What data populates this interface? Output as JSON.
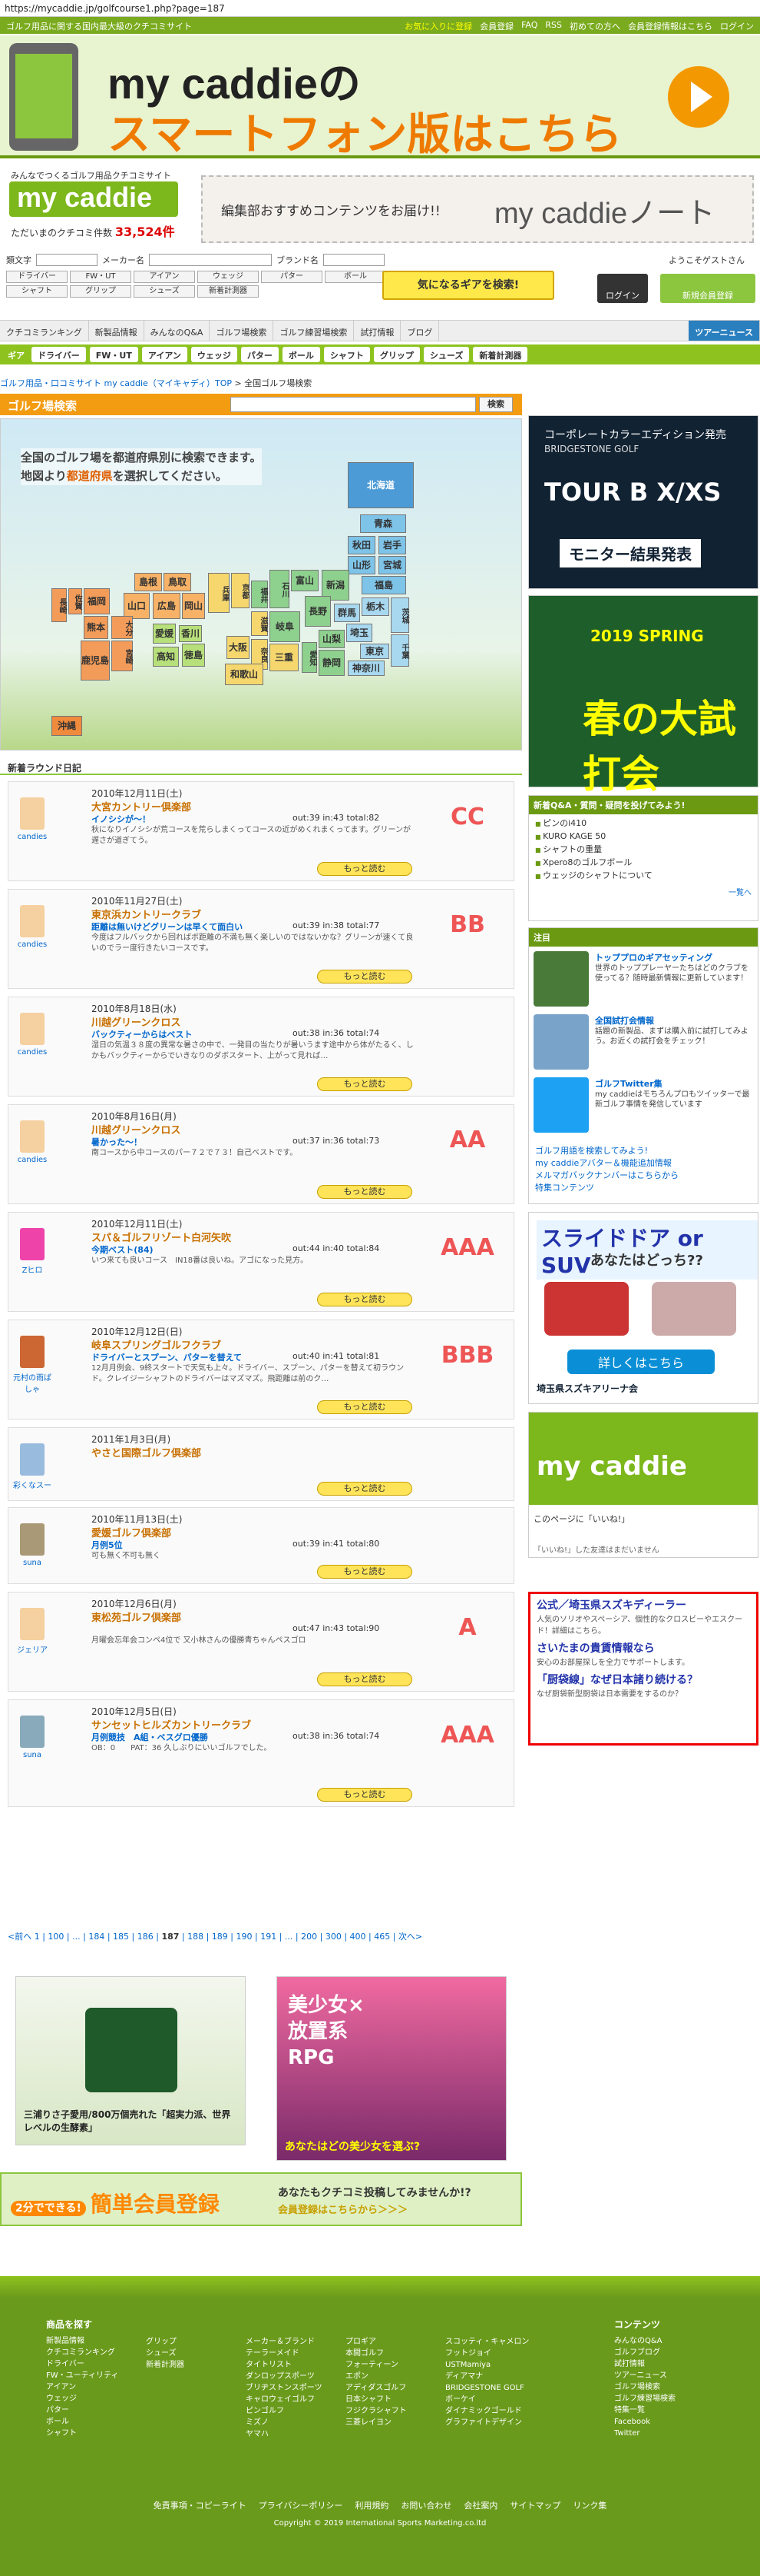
{
  "url": "https://mycaddie.jp/golfcourse1.php?page=187",
  "topbar": {
    "tagline": "ゴルフ用品に関する国内最大級のクチコミサイト",
    "links": [
      "お気に入りに登録",
      "会員登録",
      "FAQ",
      "RSS",
      "初めての方へ",
      "会員登録情報はこちら",
      "ログイン"
    ]
  },
  "smart_banner": {
    "line1": "my caddieの",
    "line2": "スマートフォン版はこちら"
  },
  "logo": {
    "sub": "みんなでつくるゴルフ用品クチコミサイト",
    "name": "my caddie",
    "count_label": "ただいまのクチコミ件数",
    "count": "33,524件"
  },
  "note_banner": {
    "text": "編集部おすすめコンテンツをお届け!!",
    "brand": "my caddieノート"
  },
  "search": {
    "labels": [
      "類文字",
      "メーカー名",
      "ブランド名"
    ],
    "keywords": [
      "ドライバー",
      "FW・UT",
      "アイアン",
      "ウェッジ",
      "パター",
      "ボール",
      "シャフト",
      "グリップ",
      "シューズ",
      "新着計測器"
    ],
    "button": "気になるギアを検索!",
    "welcome": "ようこそゲストさん",
    "login": "ログイン",
    "register": "新規会員登録"
  },
  "nav": [
    "クチコミランキング",
    "新製品情報",
    "みんなのQ&A",
    "ゴルフ場検索",
    "ゴルフ練習場検索",
    "試打情報",
    "ブログ",
    "ツアーニュース"
  ],
  "gear": {
    "label": "ギア",
    "items": [
      "ドライバー",
      "FW・UT",
      "アイアン",
      "ウェッジ",
      "パター",
      "ボール",
      "シャフト",
      "グリップ",
      "シューズ",
      "新着計測器"
    ]
  },
  "breadcrumb": [
    "ゴルフ用品・口コミサイト my caddie（マイキャディ）TOP",
    "全国ゴルフ場検索"
  ],
  "golf": {
    "heading": "ゴルフ場検索",
    "search_button": "検索",
    "intro1": "全国のゴルフ場を都道府県別に検索できます。",
    "intro2_a": "地図より",
    "intro2_em": "都道府県",
    "intro2_b": "を選択してください。"
  },
  "prefs": [
    "北海道",
    "青森",
    "秋田",
    "岩手",
    "山形",
    "宮城",
    "福島",
    "新潟",
    "栃木",
    "茨城",
    "群馬",
    "埼玉",
    "千葉",
    "東京",
    "神奈川",
    "山梨",
    "長野",
    "富山",
    "石川",
    "福井",
    "岐阜",
    "静岡",
    "愛知",
    "三重",
    "滋賀",
    "京都",
    "大阪",
    "兵庫",
    "奈良",
    "和歌山",
    "鳥取",
    "島根",
    "岡山",
    "広島",
    "山口",
    "香川",
    "徳島",
    "愛媛",
    "高知",
    "福岡",
    "佐賀",
    "長崎",
    "熊本",
    "大分",
    "宮崎",
    "鹿児島",
    "沖縄"
  ],
  "reports_heading": "新着ラウンド日記",
  "reports": [
    {
      "user": "candies",
      "date": "2010年12月11日(土)",
      "course": "大宮カントリー倶楽部",
      "title": "イノシシが～！",
      "body": "秋になりイノシシが荒コースを荒らしまくってコースの近がめくれまくってます。グリーンが遅さが道ぎてう。",
      "score": "out:39 in:43 total:82",
      "rank": "CC",
      "more": "もっと読む"
    },
    {
      "user": "candies",
      "date": "2010年11月27日(土)",
      "course": "東京浜カントリークラブ",
      "title": "距離は無いけどグリーンは早くて面白い",
      "body": "今度はフルバックから回ればボ距離の不満も無く楽しいのではないかな？グリーンが速くて良いのでラー度行きたいコースです。",
      "score": "out:39 in:38 total:77",
      "rank": "BB",
      "more": "もっと読む"
    },
    {
      "user": "candies",
      "date": "2010年8月18日(水)",
      "course": "川越グリーンクロス",
      "title": "バックティーからはベスト",
      "body": "湿日の気温３８度の異常な暑さの中で、一発目の当たりが暑いうます途中から体がたるく、しかもバックティーからでいきなりのダボスタート、上がって見れば…",
      "score": "out:38 in:36 total:74",
      "rank": "",
      "more": "もっと読む"
    },
    {
      "user": "candies",
      "date": "2010年8月16日(月)",
      "course": "川越グリーンクロス",
      "title": "暑かった～！",
      "body": "南コースから中コースのパー７２で７３！自己ベストです。",
      "score": "out:37 in:36 total:73",
      "rank": "AA",
      "more": "もっと読む"
    },
    {
      "user": "Zヒロ",
      "date": "2010年12月11日(土)",
      "course": "スパ＆ゴルフリゾート白河矢吹",
      "title": "今期ベスト(84)",
      "body": "いつ来ても良いコース　IN18番は良いね。アゴになった見方。",
      "score": "out:44 in:40 total:84",
      "rank": "AAA",
      "more": "もっと読む"
    },
    {
      "user": "元村の雨ぱしゃ",
      "date": "2010年12月12日(日)",
      "course": "岐阜スプリングゴルフクラブ",
      "title": "ドライバーとスプーン、パターを替えて",
      "body": "12月月例会、9終スタートで天気も上々。ドライバー、スプーン、パターを替えて初ラウンド。クレイジーシャフトのドライバーはマズマズ。飛距離は前のク…",
      "score": "out:40 in:41 total:81",
      "rank": "BBB",
      "more": "もっと読む"
    },
    {
      "user": "彩くなスー",
      "date": "2011年1月3日(月)",
      "course": "やさと国際ゴルフ倶楽部",
      "title": "",
      "body": "",
      "score": "",
      "rank": "",
      "more": "もっと読む"
    },
    {
      "user": "suna",
      "date": "2010年11月13日(土)",
      "course": "愛媛ゴルフ倶楽部",
      "title": "月例5位",
      "body": "可も無く不可も無く",
      "score": "out:39 in:41 total:80",
      "rank": "",
      "more": "もっと読む"
    },
    {
      "user": "ジェリア",
      "date": "2010年12月6日(月)",
      "course": "東松苑ゴルフ倶楽部",
      "title": "",
      "body": "月曜会忘年会コンペ4位で 又小林さんの優勝青ちゃんペスゴロ",
      "score": "out:47 in:43 total:90",
      "rank": "A",
      "more": "もっと読む"
    },
    {
      "user": "suna",
      "date": "2010年12月5日(日)",
      "course": "サンセットヒルズカントリークラブ",
      "title": "月例競技　A組・ベスグロ優勝",
      "body": "OB：0　　PAT：36 久しぶりにいいゴルフでした。",
      "score": "out:38 in:36 total:74",
      "rank": "AAA",
      "more": "もっと読む"
    }
  ],
  "pager": {
    "prev": "<前へ",
    "pages": [
      "1",
      "100",
      "...",
      "184",
      "185",
      "186",
      "187",
      "188",
      "189",
      "190",
      "191",
      "...",
      "200",
      "300",
      "400",
      "465"
    ],
    "current": "187",
    "next": "次へ>"
  },
  "ads_bottom": {
    "left_caption": "三浦りさ子愛用/800万個売れた「超実力派、世界レベルの生酵素」",
    "right_caption": "あなたはどの美少女を選ぶ?",
    "right_title": "美少女×放置系RPG"
  },
  "register_banner": {
    "big": "簡単会員登録",
    "small1": "あなたもクチコミ投稿してみませんか!?",
    "small2": "会員登録はこちらから＞＞＞",
    "badge": "2分でできる!"
  },
  "right": {
    "tour": {
      "a": "コーポレートカラーエディション発売",
      "b": "BRIDGESTONE GOLF",
      "c": "TOUR B X/XS",
      "d": "モニター結果発表"
    },
    "spring": {
      "a": "2019 SPRING",
      "b": "春の大試打会"
    },
    "qa": {
      "heading": "新着Q&A・質問・疑問を投げてみよう!",
      "items": [
        "ピンのi410",
        "KURO KAGE 50",
        "シャフトの重量",
        "Xpero8のゴルフボール",
        "ウェッジのシャフトについて"
      ],
      "more": "一覧へ"
    },
    "news": {
      "heading": "注目",
      "items": [
        {
          "t": "トッププロのギアセッティング",
          "b": "世界のトッププレーヤーたちはどのクラブを使ってる？随時最新情報に更新しています！"
        },
        {
          "t": "全国試打会情報",
          "b": "話題の新製品、まずは購入前に試打してみよう。お近くの試打会をチェック！"
        },
        {
          "t": "ゴルフTwitter集",
          "b": "my caddieはモちろんプロもツイッターで最新ゴルフ事情を発信しています"
        }
      ],
      "links": [
        "ゴルフ用語を検索してみよう!",
        "my caddieアバター＆機能追加情報",
        "メルマガバックナンバーはこちらから",
        "特集コンテンツ"
      ]
    },
    "suv": {
      "a": "スライドドア or SUV",
      "b": "あなたはどっち??",
      "c": "詳しくはこちら",
      "d": "埼玉県スズキアリーナ会"
    },
    "mcfb": {
      "a": "my caddie",
      "b": "このページに「いいね!」",
      "c": "「いいね!」した友達はまだいません"
    },
    "adred": [
      {
        "t": "公式／埼玉県スズキディーラー",
        "s": "人気のソリオやスペーシア、個性的なクロスビーやエスクード！詳細はこちら。"
      },
      {
        "t": "さいたまの貴賃情報なら",
        "s": "安心のお部屋探しを全力でサポートします。"
      },
      {
        "t": "「厨袋線」なぜ日本諸り続ける？",
        "s": "なぜ厨袋新型厨袋は日本需要をするのか？"
      }
    ]
  },
  "footer": {
    "c1_head": "商品を探す",
    "c1": [
      "新製品情報",
      "クチコミランキング",
      "ドライバー",
      "FW・ユーティリティ",
      "アイアン",
      "ウェッジ",
      "パター",
      "ボール",
      "シャフト"
    ],
    "c2": [
      "グリップ",
      "シューズ",
      "新着計測器"
    ],
    "c3": [
      "メーカー＆ブランド",
      "テーラーメイド",
      "タイトリスト",
      "ダンロップスポーツ",
      "ブリヂストンスポーツ",
      "キャロウェイゴルフ",
      "ピンゴルフ",
      "ミズノ",
      "ヤマハ"
    ],
    "c4": [
      "プロギア",
      "本間ゴルフ",
      "フォーティーン",
      "エポン",
      "アディダスゴルフ",
      "日本シャフト",
      "フジクラシャフト",
      "三菱レイヨン"
    ],
    "c5": [
      "スコッティ・キャメロン",
      "フットジョイ",
      "USTMamiya",
      "ディアマナ",
      "BRIDGESTONE GOLF",
      "ボーケイ",
      "ダイナミックゴールド",
      "グラファイトデザイン"
    ],
    "c6_head": "コンテンツ",
    "c6": [
      "みんなのQ&A",
      "ゴルフブログ",
      "試打情報",
      "ツアーニュース",
      "ゴルフ場検索",
      "ゴルフ練習場検索",
      "特集一覧",
      "Facebook",
      "Twitter"
    ],
    "links": [
      "免責事項・コピーライト",
      "プライバシーポリシー",
      "利用規約",
      "お問い合わせ",
      "会社案内",
      "サイトマップ",
      "リンク集"
    ],
    "copyright": "Copyright © 2019 International Sports Marketing.co.ltd"
  },
  "colors": {
    "brand_green": "#8cc63f",
    "accent_orange": "#f39c12",
    "rank_red": "#e55"
  }
}
